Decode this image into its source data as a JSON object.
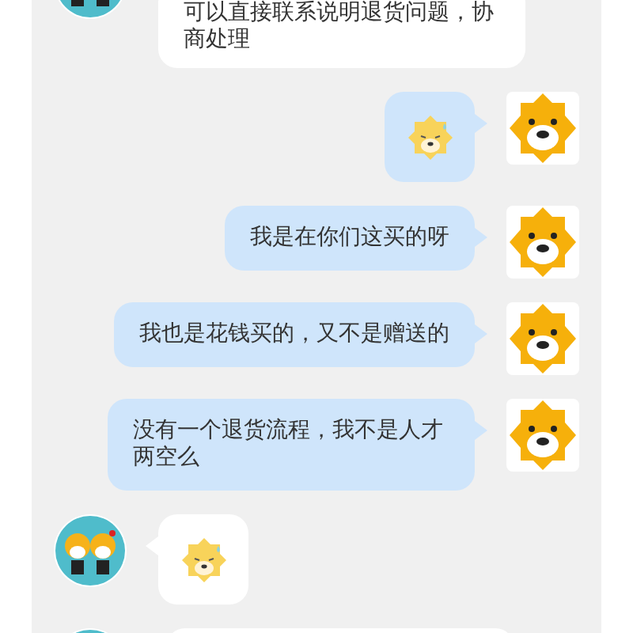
{
  "messages": [
    {
      "sent": false,
      "kind": "text",
      "text": "可以直接联系说明退货问题，协商处理"
    },
    {
      "sent": true,
      "kind": "sticker"
    },
    {
      "sent": true,
      "kind": "text",
      "text": "我是在你们这买的呀"
    },
    {
      "sent": true,
      "kind": "text",
      "text": "我也是花钱买的，又不是赠送的"
    },
    {
      "sent": true,
      "kind": "text",
      "text": "没有一个退货流程，我不是人才两空么"
    },
    {
      "sent": false,
      "kind": "sticker"
    },
    {
      "sent": false,
      "kind": "partial"
    }
  ]
}
